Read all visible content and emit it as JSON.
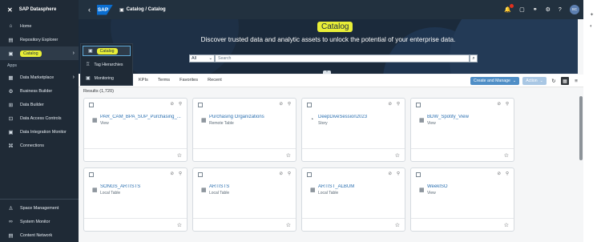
{
  "sidebar": {
    "app_title": "SAP Datasphere",
    "items_top": [
      {
        "label": "Home",
        "icon": "home-icon",
        "glyph": "⌂"
      },
      {
        "label": "Repository Explorer",
        "icon": "folder-icon",
        "glyph": "▤"
      },
      {
        "label": "Catalog",
        "icon": "catalog-icon",
        "glyph": "▣"
      }
    ],
    "section_label": "Apps",
    "items_apps": [
      {
        "label": "Data Marketplace",
        "icon": "marketplace-icon",
        "glyph": "▦"
      },
      {
        "label": "Business Builder",
        "icon": "business-builder-icon",
        "glyph": "⚙"
      },
      {
        "label": "Data Builder",
        "icon": "data-builder-icon",
        "glyph": "⊞"
      },
      {
        "label": "Data Access Controls",
        "icon": "lock-icon",
        "glyph": "⊡"
      },
      {
        "label": "Data Integration Monitor",
        "icon": "monitor-icon",
        "glyph": "▣"
      },
      {
        "label": "Connections",
        "icon": "connections-icon",
        "glyph": "⌘"
      }
    ],
    "items_bottom": [
      {
        "label": "Space Management",
        "icon": "space-icon",
        "glyph": "♙"
      },
      {
        "label": "System Monitor",
        "icon": "system-monitor-icon",
        "glyph": "∞"
      },
      {
        "label": "Content Network",
        "icon": "content-network-icon",
        "glyph": "▤"
      }
    ]
  },
  "submenu": {
    "items": [
      {
        "label": "Catalog",
        "icon": "catalog-icon",
        "glyph": "▣"
      },
      {
        "label": "Tag Hierarchies",
        "icon": "tag-icon",
        "glyph": "♖"
      },
      {
        "label": "Monitoring",
        "icon": "monitoring-icon",
        "glyph": "▣"
      }
    ]
  },
  "topbar": {
    "logo": "SAP",
    "breadcrumb": "Catalog / Catalog",
    "avatar": "SC"
  },
  "banner": {
    "title": "Catalog",
    "tagline": "Discover trusted data and analytic assets to unlock the potential of your enterprise data.",
    "filter_value": "All",
    "search_placeholder": "Search"
  },
  "tabs": [
    "KPIs",
    "Terms",
    "Favorites",
    "Recent"
  ],
  "actions": {
    "create_manage": "Create and Manage",
    "action": "Action"
  },
  "results_label": "Results (1,720)",
  "cards": [
    {
      "name": "PAR_CAM_BPA_SUP_Purchasing_...",
      "type": "View",
      "icon": "view-icon",
      "glyph": "▦"
    },
    {
      "name": "Purchasing Organizations",
      "type": "Remote Table",
      "icon": "table-icon",
      "glyph": "▦"
    },
    {
      "name": "DeepDiveSession2023",
      "type": "Story",
      "icon": "story-icon",
      "glyph": "◔"
    },
    {
      "name": "BDW_Spotify_View",
      "type": "View",
      "icon": "view-icon",
      "glyph": "▦"
    },
    {
      "name": "SONGS_ARTISTS",
      "type": "Local Table",
      "icon": "table-icon",
      "glyph": "▦"
    },
    {
      "name": "ARTISTS",
      "type": "Local Table",
      "icon": "table-icon",
      "glyph": "▦"
    },
    {
      "name": "ARTIST_ALBUM",
      "type": "Local Table",
      "icon": "table-icon",
      "glyph": "▦"
    },
    {
      "name": "WeekISO",
      "type": "View",
      "icon": "view-icon",
      "glyph": "▦"
    }
  ],
  "colors": {
    "highlight": "#e8ee37",
    "shell": "#1f2a36",
    "link": "#2a6fb0",
    "primary_button": "#4f8ec6"
  }
}
